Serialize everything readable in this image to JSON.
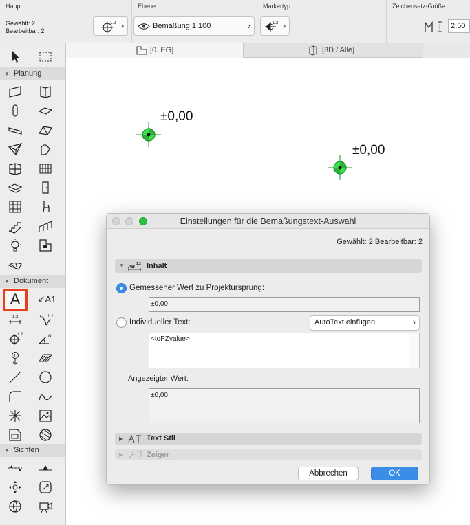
{
  "infobar": {
    "haupt": {
      "title": "Haupt:",
      "selected": "Gewählt: 2",
      "editable": "Bearbeitbar: 2"
    },
    "ebene": {
      "title": "Ebene:",
      "value": "Bemaßung 1:100"
    },
    "markertyp": {
      "title": "Markertyp:"
    },
    "font_size": {
      "title": "Zeichensatz-Größe:",
      "value": "2,50"
    }
  },
  "toolbox": {
    "groups": {
      "planung": "Planung",
      "dokument": "Dokument",
      "sichten": "Sichten"
    },
    "text_tool_label": "A",
    "label_tool_label": "A1",
    "dim_code": "1.2",
    "angle_code": "α",
    "marker_num": "1"
  },
  "tabs": [
    {
      "label": "[0. EG]"
    },
    {
      "label": "[3D / Alle]"
    }
  ],
  "canvas": {
    "markers": [
      {
        "label": "±0,00"
      },
      {
        "label": "±0,00"
      }
    ]
  },
  "dialog": {
    "title": "Einstellungen für die Bemaßungstext-Auswahl",
    "status": "Gewählt: 2 Bearbeitbar: 2",
    "section_inhalt": "Inhalt",
    "section_icon_text": "AB",
    "section_icon_sup": "1.2",
    "option_measured": "Gemessener Wert zu Projektursprung:",
    "measured_value": "±0,00",
    "option_custom": "Individueller Text:",
    "autotext_label": "AutoText einfügen",
    "custom_text": "<toPZvalue>",
    "displayed_label": "Angezeigter Wert:",
    "displayed_value": "±0,00",
    "section_textstil": "Text Stil",
    "section_zeiger": "Zeiger",
    "cancel_label": "Abbrechen",
    "ok_label": "OK"
  },
  "colors": {
    "accent": "#3b8ee8",
    "selection": "#e8401c",
    "marker": "#3ee04a"
  }
}
